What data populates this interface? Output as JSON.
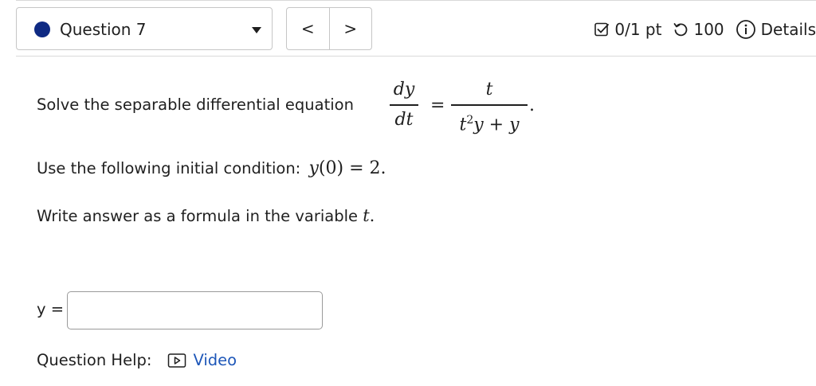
{
  "header": {
    "question_label": "Question 7",
    "prev_label": "<",
    "next_label": ">",
    "score": "0/1 pt",
    "attempts": "100",
    "details_label": "Details"
  },
  "problem": {
    "intro": "Solve the separable differential equation",
    "lhs_num": "dy",
    "lhs_den": "dt",
    "equals": "=",
    "rhs_num": "t",
    "rhs_den_t": "t",
    "rhs_den_sup": "2",
    "rhs_den_rest": "y + y",
    "period": ".",
    "initial_text": "Use the following initial condition:",
    "initial_math_y": "y",
    "initial_math_rest": "(0)",
    "initial_eq": "=",
    "initial_val": "2.",
    "formula_text": "Write answer as a formula in the variable",
    "formula_var": "t",
    "formula_period": "."
  },
  "answer": {
    "label": "y =",
    "value": "",
    "placeholder": ""
  },
  "help": {
    "label": "Question Help:",
    "video_label": "Video"
  },
  "colors": {
    "question_dot": "#0f2a83",
    "link": "#1d56b8",
    "border": "#c6c6c6"
  },
  "icons": {
    "score": "checkbox-icon",
    "attempts": "retry-icon",
    "details": "info-icon",
    "video": "video-play-icon"
  }
}
